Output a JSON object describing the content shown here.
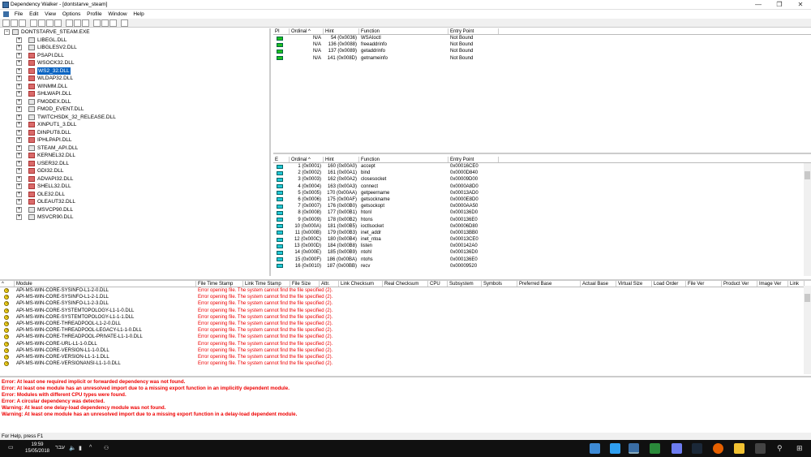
{
  "window": {
    "title": "Dependency Walker - [dontstarve_steam]",
    "min": "—",
    "max": "❐",
    "close": "✕"
  },
  "menu": [
    "File",
    "Edit",
    "View",
    "Options",
    "Profile",
    "Window",
    "Help"
  ],
  "toolbar": [
    "open-icon",
    "save-icon",
    "copy-icon",
    "find-icon",
    "profile-icon",
    "refresh-icon",
    "view-fullpaths-icon",
    "undecorate-icon",
    "expand-icon",
    "collapse-icon",
    "module-view-icon",
    "tile-horizontal-icon",
    "tile-vertical-icon",
    "help-icon"
  ],
  "tree": {
    "root": "DONTSTARVE_STEAM.EXE",
    "items": [
      {
        "name": "LIBEGL.DLL",
        "icon": "plain"
      },
      {
        "name": "LIBGLESV2.DLL",
        "icon": "plain"
      },
      {
        "name": "PSAPI.DLL",
        "icon": "red"
      },
      {
        "name": "WSOCK32.DLL",
        "icon": "red"
      },
      {
        "name": "WS2_32.DLL",
        "icon": "red",
        "selected": true
      },
      {
        "name": "WLDAP32.DLL",
        "icon": "red"
      },
      {
        "name": "WINMM.DLL",
        "icon": "red"
      },
      {
        "name": "SHLWAPI.DLL",
        "icon": "red"
      },
      {
        "name": "FMODEX.DLL",
        "icon": "plain"
      },
      {
        "name": "FMOD_EVENT.DLL",
        "icon": "plain"
      },
      {
        "name": "TWITCHSDK_32_RELEASE.DLL",
        "icon": "plain"
      },
      {
        "name": "XINPUT1_3.DLL",
        "icon": "red"
      },
      {
        "name": "DINPUT8.DLL",
        "icon": "red"
      },
      {
        "name": "IPHLPAPI.DLL",
        "icon": "red"
      },
      {
        "name": "STEAM_API.DLL",
        "icon": "plain"
      },
      {
        "name": "KERNEL32.DLL",
        "icon": "red"
      },
      {
        "name": "USER32.DLL",
        "icon": "red"
      },
      {
        "name": "GDI32.DLL",
        "icon": "red"
      },
      {
        "name": "ADVAPI32.DLL",
        "icon": "red"
      },
      {
        "name": "SHELL32.DLL",
        "icon": "red"
      },
      {
        "name": "OLE32.DLL",
        "icon": "red"
      },
      {
        "name": "OLEAUT32.DLL",
        "icon": "red"
      },
      {
        "name": "MSVCP90.DLL",
        "icon": "plain"
      },
      {
        "name": "MSVCR90.DLL",
        "icon": "plain"
      }
    ]
  },
  "imports": {
    "headers": [
      "PI",
      "Ordinal ^",
      "Hint",
      "Function",
      "Entry Point"
    ],
    "rows": [
      [
        "N/A",
        "54 (0x0036)",
        "WSAIoctl",
        "Not Bound"
      ],
      [
        "N/A",
        "136 (0x0088)",
        "freeaddrinfo",
        "Not Bound"
      ],
      [
        "N/A",
        "137 (0x0089)",
        "getaddrinfo",
        "Not Bound"
      ],
      [
        "N/A",
        "141 (0x008D)",
        "getnameinfo",
        "Not Bound"
      ]
    ]
  },
  "exports": {
    "headers": [
      "E",
      "Ordinal ^",
      "Hint",
      "Function",
      "Entry Point"
    ],
    "rows": [
      [
        "1 (0x0001)",
        "160 (0x00A0)",
        "accept",
        "0x00016CE0"
      ],
      [
        "2 (0x0002)",
        "161 (0x00A1)",
        "bind",
        "0x0000D840"
      ],
      [
        "3 (0x0003)",
        "162 (0x00A2)",
        "closesocket",
        "0x00009D00"
      ],
      [
        "4 (0x0004)",
        "163 (0x00A3)",
        "connect",
        "0x0000A8D0"
      ],
      [
        "5 (0x0005)",
        "170 (0x00AA)",
        "getpeername",
        "0x00013AD0"
      ],
      [
        "6 (0x0006)",
        "175 (0x00AF)",
        "getsockname",
        "0x0000E8D0"
      ],
      [
        "7 (0x0007)",
        "176 (0x00B0)",
        "getsockopt",
        "0x0000AA50"
      ],
      [
        "8 (0x0008)",
        "177 (0x00B1)",
        "htonl",
        "0x000136D0"
      ],
      [
        "9 (0x0009)",
        "178 (0x00B2)",
        "htons",
        "0x000136E0"
      ],
      [
        "10 (0x000A)",
        "181 (0x00B5)",
        "ioctlsocket",
        "0x00006D80"
      ],
      [
        "11 (0x000B)",
        "179 (0x00B3)",
        "inet_addr",
        "0x00013BB0"
      ],
      [
        "12 (0x000C)",
        "180 (0x00B4)",
        "inet_ntoa",
        "0x00013CE0"
      ],
      [
        "13 (0x000D)",
        "184 (0x00B8)",
        "listen",
        "0x000142A0"
      ],
      [
        "14 (0x000E)",
        "185 (0x00B9)",
        "ntohl",
        "0x000136D0"
      ],
      [
        "15 (0x000F)",
        "186 (0x00BA)",
        "ntohs",
        "0x000136E0"
      ],
      [
        "16 (0x0010)",
        "187 (0x00BB)",
        "recv",
        "0x00009520"
      ]
    ]
  },
  "modules": {
    "headers": [
      "^",
      "Module",
      "File Time Stamp",
      "Link Time Stamp",
      "File Size",
      "Attr.",
      "Link Checksum",
      "Real Checksum",
      "CPU",
      "Subsystem",
      "Symbols",
      "Preferred Base",
      "Actual Base",
      "Virtual Size",
      "Load Order",
      "File Ver",
      "Product Ver",
      "Image Ver",
      "Link"
    ],
    "error": "Error opening file. The system cannot find the file specified (2).",
    "rows": [
      "API-MS-WIN-CORE-SYSINFO-L1-2-0.DLL",
      "API-MS-WIN-CORE-SYSINFO-L1-2-1.DLL",
      "API-MS-WIN-CORE-SYSINFO-L1-2-3.DLL",
      "API-MS-WIN-CORE-SYSTEMTOPOLOGY-L1-1-0.DLL",
      "API-MS-WIN-CORE-SYSTEMTOPOLOGY-L1-1-1.DLL",
      "API-MS-WIN-CORE-THREADPOOL-L1-2-0.DLL",
      "API-MS-WIN-CORE-THREADPOOL-LEGACY-L1-1-0.DLL",
      "API-MS-WIN-CORE-THREADPOOL-PRIVATE-L1-1-0.DLL",
      "API-MS-WIN-CORE-URL-L1-1-0.DLL",
      "API-MS-WIN-CORE-VERSION-L1-1-0.DLL",
      "API-MS-WIN-CORE-VERSION-L1-1-1.DLL",
      "API-MS-WIN-CORE-VERSIONANSI-L1-1-0.DLL"
    ]
  },
  "log": [
    "Error: At least one required implicit or forwarded dependency was not found.",
    "Error: At least one module has an unresolved import due to a missing export function in an implicitly dependent module.",
    "Error: Modules with different CPU types were found.",
    "Error: A circular dependency was detected.",
    "Warning: At least one delay-load dependency module was not found.",
    "Warning: At least one module has an unresolved import due to a missing export function in a delay-load dependent module."
  ],
  "status": "For Help, press F1",
  "taskbar": {
    "time": "19:59",
    "date": "15/05/2018",
    "lang": "עבר"
  }
}
